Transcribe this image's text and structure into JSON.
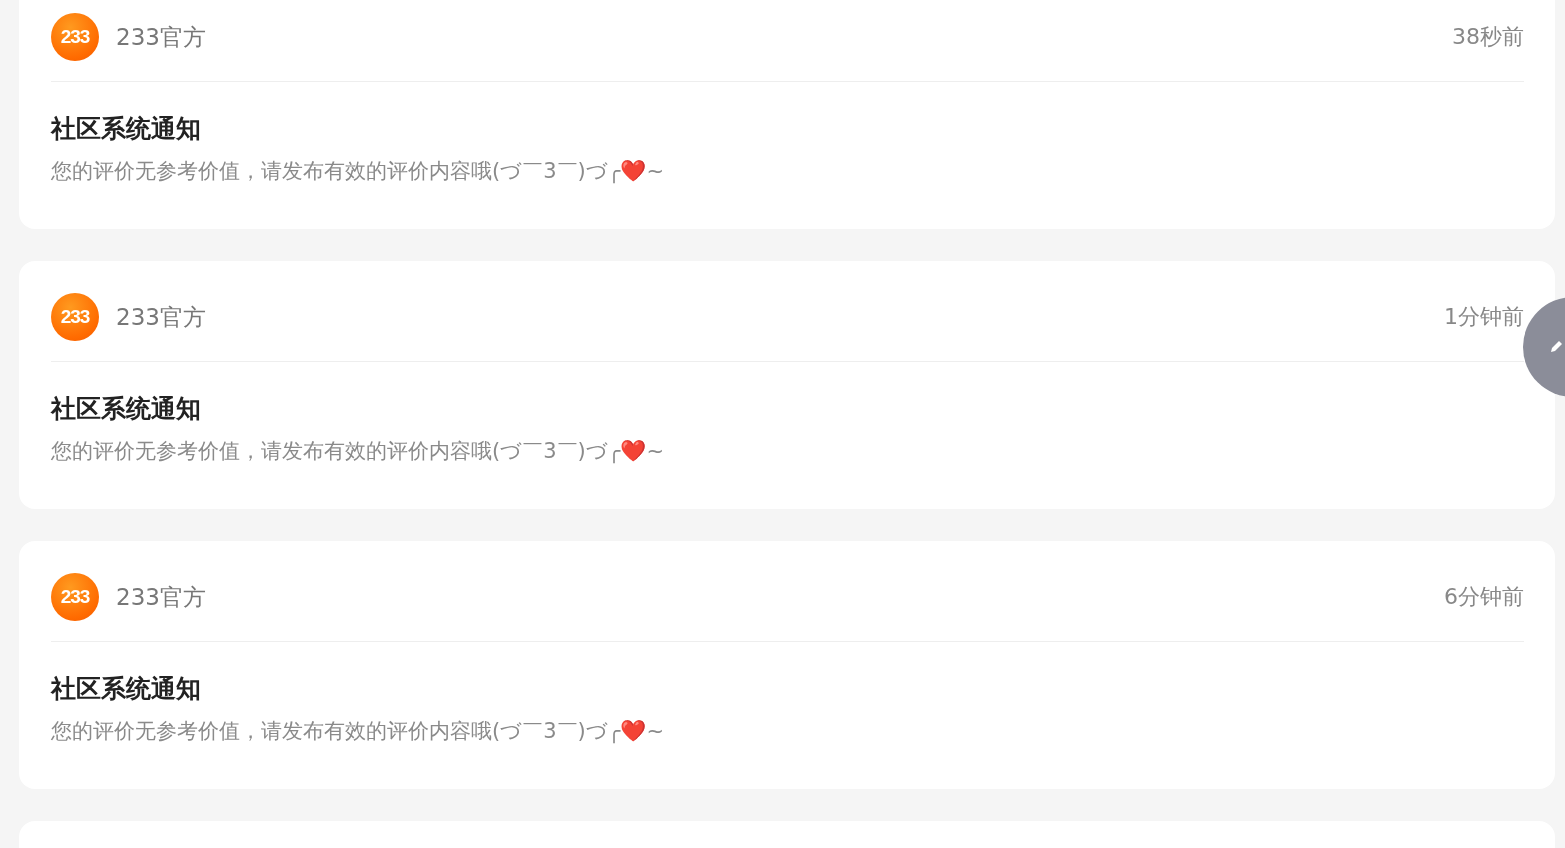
{
  "notifications": [
    {
      "avatar_text": "233",
      "sender": "233官方",
      "time": "38秒前",
      "title": "社区系统通知",
      "message": "您的评价无参考价值，请发布有效的评价内容哦(づ￣3￣)づ╭❤️~"
    },
    {
      "avatar_text": "233",
      "sender": "233官方",
      "time": "1分钟前",
      "title": "社区系统通知",
      "message": "您的评价无参考价值，请发布有效的评价内容哦(づ￣3￣)づ╭❤️~"
    },
    {
      "avatar_text": "233",
      "sender": "233官方",
      "time": "6分钟前",
      "title": "社区系统通知",
      "message": "您的评价无参考价值，请发布有效的评价内容哦(づ￣3￣)づ╭❤️~"
    }
  ]
}
